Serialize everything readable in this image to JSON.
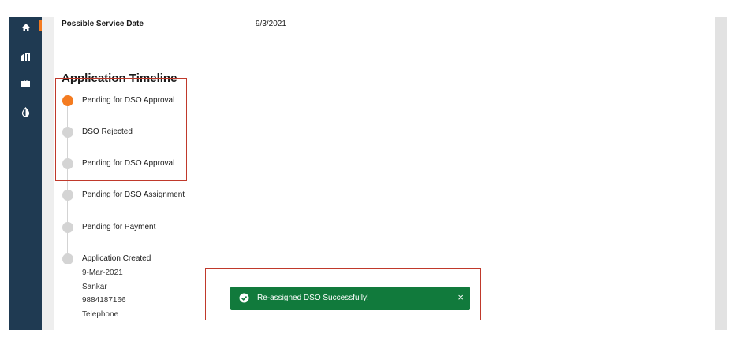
{
  "sidebar": {
    "items": [
      {
        "icon": "home-icon"
      },
      {
        "icon": "city-icon"
      },
      {
        "icon": "briefcase-icon"
      },
      {
        "icon": "contrast-icon"
      }
    ],
    "accent_color": "#f47b20",
    "background": "#1f3a52"
  },
  "details": {
    "possible_service_date_label": "Possible Service Date",
    "possible_service_date_value": "9/3/2021"
  },
  "timeline": {
    "title": "Application Timeline",
    "steps": [
      {
        "label": "Pending for DSO Approval",
        "active": true
      },
      {
        "label": "DSO Rejected",
        "active": false
      },
      {
        "label": "Pending for DSO Approval",
        "active": false
      },
      {
        "label": "Pending for DSO Assignment",
        "active": false
      },
      {
        "label": "Pending for Payment",
        "active": false
      },
      {
        "label": "Application Created",
        "active": false,
        "details": [
          "9-Mar-2021",
          "Sankar",
          "9884187166",
          "Telephone"
        ]
      }
    ]
  },
  "toast": {
    "message": "Re-assigned DSO Successfully!",
    "close_glyph": "×",
    "color": "#117a3c"
  }
}
